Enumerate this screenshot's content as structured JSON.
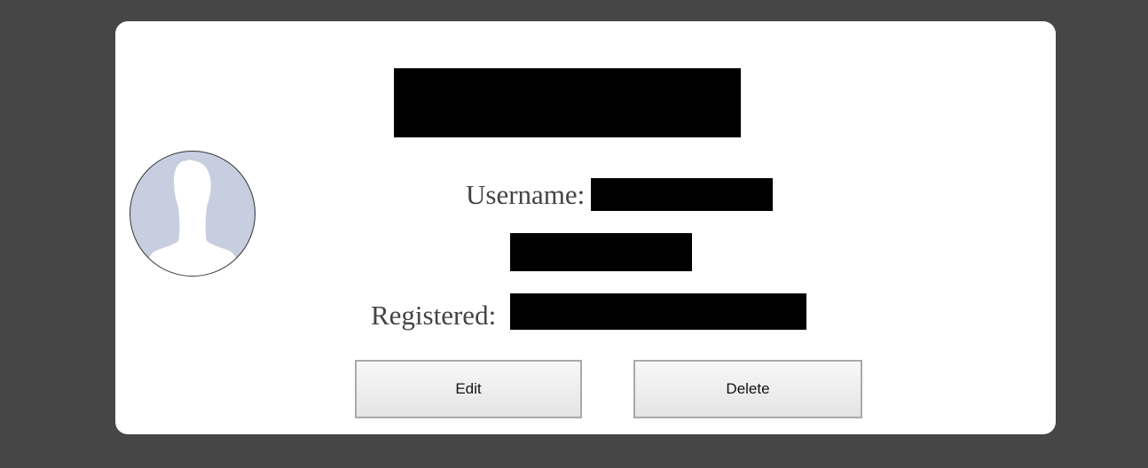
{
  "profile": {
    "username_label": "Username:",
    "registered_label": "Registered: "
  },
  "actions": {
    "edit_label": "Edit",
    "delete_label": "Delete"
  },
  "icons": {
    "avatar": "default-user-silhouette-icon"
  },
  "colors": {
    "background": "#464646",
    "card": "#ffffff",
    "text": "#444444",
    "avatar_fill": "#c7cedf",
    "redaction": "#000000"
  }
}
